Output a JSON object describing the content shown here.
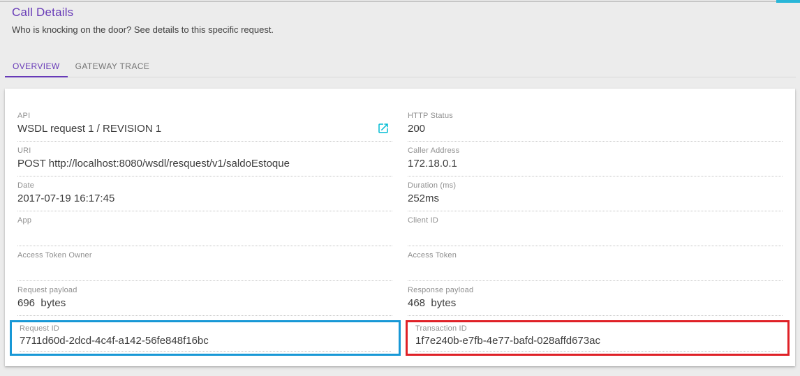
{
  "page": {
    "title": "Call Details",
    "subtitle": "Who is knocking on the door? See details to this specific request."
  },
  "tabs": [
    {
      "label": "OVERVIEW",
      "active": true
    },
    {
      "label": "GATEWAY TRACE",
      "active": false
    }
  ],
  "fields": {
    "api": {
      "label": "API",
      "value": "WSDL request 1 / REVISION 1"
    },
    "http_status": {
      "label": "HTTP Status",
      "value": "200"
    },
    "uri": {
      "label": "URI",
      "value": "POST http://localhost:8080/wsdl/resquest/v1/saldoEstoque"
    },
    "caller_address": {
      "label": "Caller Address",
      "value": "172.18.0.1"
    },
    "date": {
      "label": "Date",
      "value": "2017-07-19 16:17:45"
    },
    "duration": {
      "label": "Duration (ms)",
      "value": "252ms"
    },
    "app": {
      "label": "App",
      "value": ""
    },
    "client_id": {
      "label": "Client ID",
      "value": ""
    },
    "access_token_owner": {
      "label": "Access Token Owner",
      "value": ""
    },
    "access_token": {
      "label": "Access Token",
      "value": ""
    },
    "request_payload": {
      "label": "Request payload",
      "value": "696  bytes"
    },
    "response_payload": {
      "label": "Response payload",
      "value": "468  bytes"
    },
    "request_id": {
      "label": "Request ID",
      "value": "7711d60d-2dcd-4c4f-a142-56fe848f16bc"
    },
    "transaction_id": {
      "label": "Transaction ID",
      "value": "1f7e240b-e7fb-4e77-bafd-028affd673ac"
    }
  },
  "icons": {
    "api_open": "open-in-new-icon"
  },
  "colors": {
    "accent_purple": "#673ab7",
    "icon_cyan": "#00bcd4",
    "request_id_highlight": "#1898d6",
    "transaction_id_highlight": "#df2127",
    "top_thumb_teal": "#29b6d8",
    "page_background": "#ececec"
  }
}
